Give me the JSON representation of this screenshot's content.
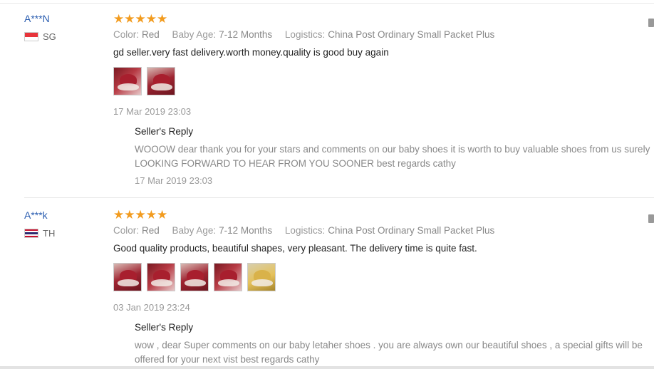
{
  "reviews": [
    {
      "user": "A***N",
      "country": "SG",
      "stars": "★★★★★",
      "rating": 5,
      "attributes": [
        {
          "key": "Color:",
          "value": "Red"
        },
        {
          "key": "Baby Age:",
          "value": "7-12 Months"
        },
        {
          "key": "Logistics:",
          "value": "China Post Ordinary Small Packet Plus"
        }
      ],
      "comment": "gd seller.very fast delivery.worth money.quality is good buy again",
      "photo_count": 2,
      "date": "17 Mar 2019 23:03",
      "reply": {
        "title": "Seller's Reply",
        "line1": "WOOOW dear thank you for your stars and comments on our baby shoes it is worth to buy valuable shoes from us surely",
        "line2": "LOOKING FORWARD TO HEAR FROM YOU SOONER best regards cathy",
        "date": "17 Mar 2019 23:03"
      }
    },
    {
      "user": "A***k",
      "country": "TH",
      "stars": "★★★★★",
      "rating": 5,
      "attributes": [
        {
          "key": "Color:",
          "value": "Red"
        },
        {
          "key": "Baby Age:",
          "value": "7-12 Months"
        },
        {
          "key": "Logistics:",
          "value": "China Post Ordinary Small Packet Plus"
        }
      ],
      "comment": "Good quality products, beautiful shapes, very pleasant. The delivery time is quite fast.",
      "photo_count": 5,
      "date": "03 Jan 2019 23:24",
      "reply": {
        "title": "Seller's Reply",
        "line1": "wow , dear Super comments on our baby letaher shoes . you are always own our beautiful shoes , a special gifts will be",
        "line2": "offered for your next vist best regards cathy"
      }
    }
  ],
  "colors": {
    "accent_link": "#2a5db0",
    "star": "#f29b1e",
    "muted": "#999999"
  },
  "icons": [
    "flag-sg-icon",
    "flag-th-icon",
    "star-icon",
    "side-action-icon"
  ]
}
